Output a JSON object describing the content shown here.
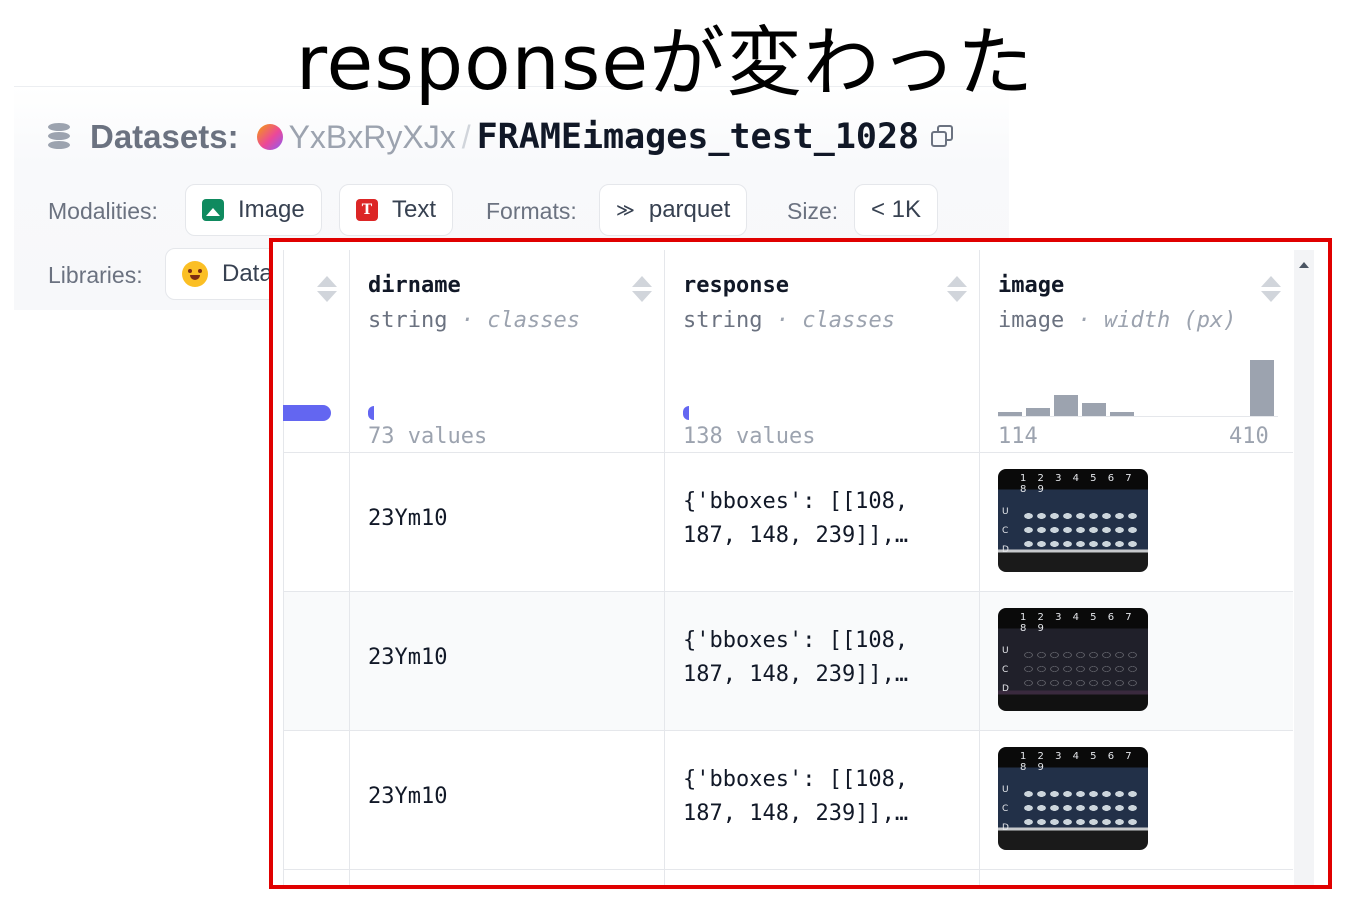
{
  "slide_title": "responseが変わった",
  "header": {
    "datasets_label": "Datasets:",
    "user": "YxBxRyXJx",
    "separator": "/",
    "repo": "FRAMEimages_test_1028",
    "icons": {
      "datasets": "database-icon",
      "copy": "copy-icon"
    }
  },
  "meta": {
    "modalities_label": "Modalities:",
    "modalities": [
      "Image",
      "Text"
    ],
    "formats_label": "Formats:",
    "format": "parquet",
    "size_label": "Size:",
    "size": "< 1K",
    "libraries_label": "Libraries:",
    "library": "Data"
  },
  "table": {
    "columns": [
      {
        "name": "dirname",
        "type": "string",
        "detail": "· classes",
        "summary": "73  values"
      },
      {
        "name": "response",
        "type": "string",
        "detail": "· classes",
        "summary": "138  values"
      },
      {
        "name": "image",
        "type": "image",
        "detail": "· width (px)",
        "hist_min": "114",
        "hist_max": "410",
        "hist": [
          0.08,
          0.14,
          0.38,
          0.24,
          0.07,
          0,
          0,
          0,
          0,
          1.0
        ]
      }
    ],
    "rows": [
      {
        "dirname": "23Ym10",
        "response_l1": "{'bboxes': [[108,",
        "response_l2": "187, 148, 239]],…"
      },
      {
        "dirname": "23Ym10",
        "response_l1": "{'bboxes': [[108,",
        "response_l2": "187, 148, 239]],…"
      },
      {
        "dirname": "23Ym10",
        "response_l1": "{'bboxes': [[108,",
        "response_l2": "187, 148, 239]],…"
      }
    ],
    "thumb_numbers": "1 2 3 4 5 6 7 8 9",
    "thumb_letters": [
      "U",
      "C",
      "D"
    ]
  },
  "highlight_color": "#e00000",
  "accent_color": "#6366f1"
}
